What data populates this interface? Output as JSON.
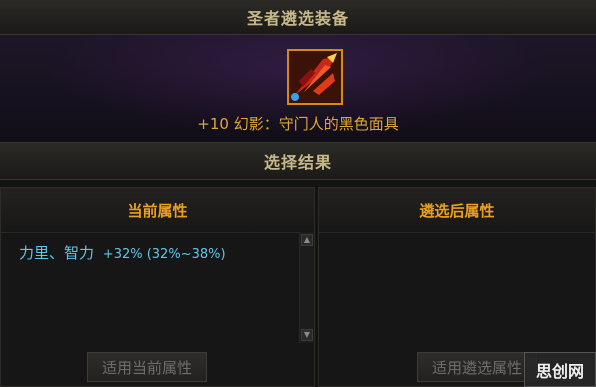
{
  "window": {
    "title": "圣者遴选装备"
  },
  "item": {
    "name": "+10 幻影：守门人的黑色面具",
    "icon": "mask-weapon-icon"
  },
  "result": {
    "title": "选择结果"
  },
  "current_panel": {
    "title": "当前属性",
    "attribute_name": "力里、智力",
    "attribute_value": "+32% (32%~38%)",
    "apply_button": "适用当前属性"
  },
  "selected_panel": {
    "title": "遴选后属性",
    "apply_button": "适用遴选属性"
  },
  "watermark": {
    "text": "思创网"
  },
  "colors": {
    "gold": "#e8a020",
    "cyan": "#5ec8e8",
    "item_name": "#e0a638"
  }
}
